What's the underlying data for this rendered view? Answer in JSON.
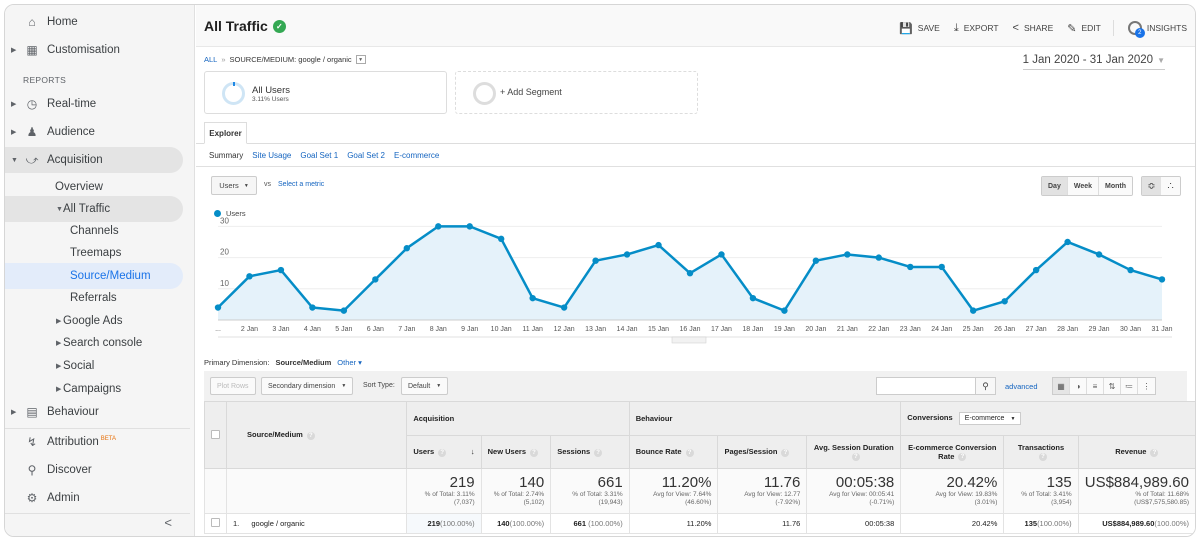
{
  "sidebar": {
    "home": "Home",
    "customisation": "Customisation",
    "reports_heading": "REPORTS",
    "realtime": "Real-time",
    "audience": "Audience",
    "acquisition": "Acquisition",
    "overview": "Overview",
    "all_traffic": "All Traffic",
    "channels": "Channels",
    "treemaps": "Treemaps",
    "source_medium": "Source/Medium",
    "referrals": "Referrals",
    "google_ads": "Google Ads",
    "search_console": "Search console",
    "social": "Social",
    "campaigns": "Campaigns",
    "behaviour": "Behaviour",
    "attribution": "Attribution",
    "attribution_badge": "BETA",
    "discover": "Discover",
    "admin": "Admin",
    "collapse": "<"
  },
  "header": {
    "title": "All Traffic",
    "actions": {
      "save": "SAVE",
      "export": "EXPORT",
      "share": "SHARE",
      "edit": "EDIT",
      "insights": "INSIGHTS",
      "insights_count": "2"
    }
  },
  "breadcrumb": {
    "all": "ALL",
    "separator": "»",
    "current": "SOURCE/MEDIUM: google / organic"
  },
  "date_range": "1 Jan 2020 - 31 Jan 2020",
  "segments": {
    "active_name": "All Users",
    "active_sub": "3.11% Users",
    "add_label": "+ Add Segment"
  },
  "explorer": {
    "tab": "Explorer",
    "subtabs": [
      "Summary",
      "Site Usage",
      "Goal Set 1",
      "Goal Set 2",
      "E-commerce"
    ]
  },
  "chart_controls": {
    "metric": "Users",
    "vs": "vs",
    "select_metric": "Select a metric",
    "time": [
      "Day",
      "Week",
      "Month"
    ],
    "active_time": "Day"
  },
  "chart_data": {
    "type": "area",
    "title": "",
    "legend": [
      "Users"
    ],
    "legend_position": "top-left",
    "series_color": "#058dc7",
    "xlabel": "",
    "ylabel": "",
    "ylim": [
      0,
      33
    ],
    "y_ticks": [
      10,
      20,
      30
    ],
    "grid": true,
    "x_tick_labels": [
      "...",
      "2 Jan",
      "3 Jan",
      "4 Jan",
      "5 Jan",
      "6 Jan",
      "7 Jan",
      "8 Jan",
      "9 Jan",
      "10 Jan",
      "11 Jan",
      "12 Jan",
      "13 Jan",
      "14 Jan",
      "15 Jan",
      "16 Jan",
      "17 Jan",
      "18 Jan",
      "19 Jan",
      "20 Jan",
      "21 Jan",
      "22 Jan",
      "23 Jan",
      "24 Jan",
      "25 Jan",
      "26 Jan",
      "27 Jan",
      "28 Jan",
      "29 Jan",
      "30 Jan",
      "31 Jan"
    ],
    "series": [
      {
        "name": "Users",
        "values": [
          4,
          14,
          16,
          4,
          3,
          13,
          23,
          30,
          30,
          26,
          7,
          4,
          19,
          21,
          24,
          15,
          21,
          7,
          3,
          19,
          21,
          20,
          17,
          17,
          3,
          6,
          16,
          25,
          21,
          16,
          13
        ]
      }
    ]
  },
  "table_controls": {
    "primary_dimension_label": "Primary Dimension:",
    "primary_dimension_value": "Source/Medium",
    "other": "Other",
    "plot_rows": "Plot Rows",
    "secondary_dimension": "Secondary dimension",
    "sort_type_label": "Sort Type:",
    "sort_type_value": "Default",
    "search_placeholder": "",
    "advanced": "advanced"
  },
  "table": {
    "dimension_header": "Source/Medium",
    "groups": {
      "acquisition": "Acquisition",
      "behaviour": "Behaviour",
      "conversions": "Conversions",
      "conversions_select": "E-commerce"
    },
    "columns": [
      "Users",
      "New Users",
      "Sessions",
      "Bounce Rate",
      "Pages/Session",
      "Avg. Session Duration",
      "E-commerce Conversion Rate",
      "Transactions",
      "Revenue"
    ],
    "totals": [
      {
        "value": "219",
        "line1": "% of Total: 3.11%",
        "line2": "(7,037)"
      },
      {
        "value": "140",
        "line1": "% of Total: 2.74%",
        "line2": "(5,102)"
      },
      {
        "value": "661",
        "line1": "% of Total: 3.31%",
        "line2": "(19,943)"
      },
      {
        "value": "11.20%",
        "line1": "Avg for View: 7.64%",
        "line2": "(46.60%)"
      },
      {
        "value": "11.76",
        "line1": "Avg for View: 12.77",
        "line2": "(-7.92%)"
      },
      {
        "value": "00:05:38",
        "line1": "Avg for View: 00:05:41",
        "line2": "(-0.71%)"
      },
      {
        "value": "20.42%",
        "line1": "Avg for View: 19.83%",
        "line2": "(3.01%)"
      },
      {
        "value": "135",
        "line1": "% of Total: 3.41%",
        "line2": "(3,954)"
      },
      {
        "value": "US$884,989.60",
        "line1": "% of Total: 11.68%",
        "line2": "(US$7,575,580.85)"
      }
    ],
    "rows": [
      {
        "index": "1.",
        "dimension": "google / organic",
        "cells": [
          {
            "value": "219",
            "pct": "(100.00%)"
          },
          {
            "value": "140",
            "pct": "(100.00%)"
          },
          {
            "value": "661",
            "pct": " (100.00%)"
          },
          {
            "value": "11.20%",
            "pct": ""
          },
          {
            "value": "11.76",
            "pct": ""
          },
          {
            "value": "00:05:38",
            "pct": ""
          },
          {
            "value": "20.42%",
            "pct": ""
          },
          {
            "value": "135",
            "pct": "(100.00%)"
          },
          {
            "value": "US$884,989.60",
            "pct": "(100.00%)"
          }
        ]
      }
    ]
  }
}
